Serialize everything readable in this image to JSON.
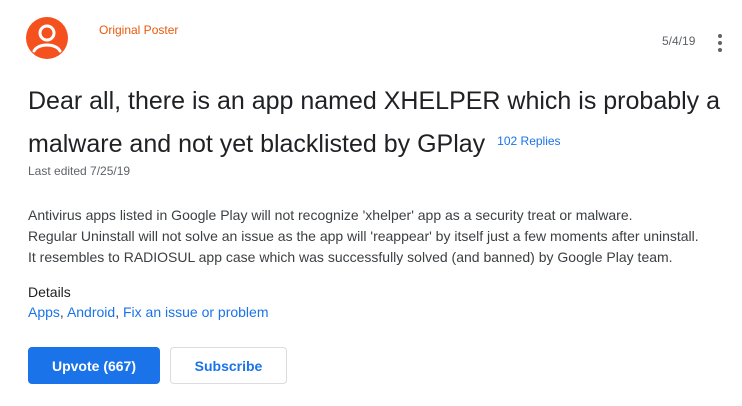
{
  "post": {
    "author_role": "Original Poster",
    "date": "5/4/19",
    "title": "Dear all, there is an app named XHELPER which is probably a malware and not yet blacklisted by GPlay",
    "replies": "102 Replies",
    "last_edited": "Last edited 7/25/19",
    "body": [
      "Antivirus apps listed in Google Play will not recognize 'xhelper' app as a security treat or malware.",
      "Regular Uninstall will not solve an issue as the app will 'reappear' by itself just a few moments after uninstall.",
      "It resembles to RADIOSUL app case which was successfully solved (and banned) by Google Play team."
    ]
  },
  "details": {
    "label": "Details",
    "links": [
      "Apps",
      "Android",
      "Fix an issue or problem"
    ],
    "separator": ", "
  },
  "actions": {
    "upvote_label": "Upvote (667)",
    "subscribe_label": "Subscribe"
  },
  "icons": {
    "avatar": "user-avatar-icon",
    "more": "more-vert-icon"
  },
  "colors": {
    "accent": "#1a73e8",
    "avatar": "#f4511e",
    "role": "#e8590c"
  }
}
